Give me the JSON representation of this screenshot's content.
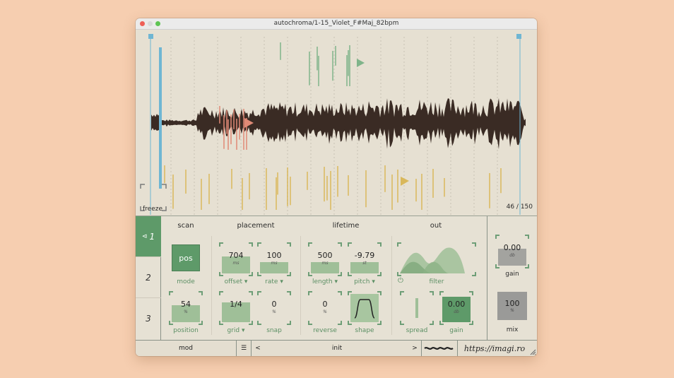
{
  "window": {
    "title": "autochroma/1-15_Violet_F#Maj_82bpm",
    "traffic_colors": [
      "#ee5f57",
      "#d9d9d9",
      "#5fc454"
    ]
  },
  "waveform": {
    "freeze_label": "freeze",
    "counter": "46 / 150",
    "colors": {
      "wave": "#3a2b24",
      "red": "#e08a76",
      "green": "#7fb48a",
      "yellow": "#d9b85b",
      "blue": "#6fb6d3"
    }
  },
  "sections": {
    "scan": "scan",
    "placement": "placement",
    "lifetime": "lifetime",
    "out": "out"
  },
  "tabs": [
    "1",
    "2",
    "3"
  ],
  "scan": {
    "mode": {
      "value": "pos",
      "label": "mode"
    },
    "position": {
      "value": "54",
      "unit": "%",
      "label": "position",
      "fill": 0.45
    }
  },
  "placement": {
    "offset": {
      "value": "704",
      "unit": "ms",
      "label": "offset",
      "fill": 0.55
    },
    "rate": {
      "value": "100",
      "unit": "ms",
      "label": "rate",
      "fill": 0.35
    },
    "grid": {
      "value": "1/4",
      "unit": "",
      "label": "grid",
      "fill": 0.6
    },
    "snap": {
      "value": "0",
      "unit": "%",
      "label": "snap",
      "fill": 0.0
    }
  },
  "lifetime": {
    "length": {
      "value": "500",
      "unit": "ms",
      "label": "length",
      "fill": 0.35
    },
    "pitch": {
      "value": "-9.79",
      "unit": "st",
      "label": "pitch",
      "fill": 0.35
    },
    "reverse": {
      "value": "0",
      "unit": "%",
      "label": "reverse",
      "fill": 0.0
    },
    "shape": {
      "label": "shape"
    }
  },
  "out": {
    "filter": {
      "label": "filter"
    },
    "spread": {
      "label": "spread"
    },
    "gain": {
      "value": "0.00",
      "unit": "db",
      "label": "gain",
      "fill": 0.7
    }
  },
  "master": {
    "gain": {
      "value": "0.00",
      "unit": "db",
      "label": "gain"
    },
    "mix": {
      "value": "100",
      "unit": "%",
      "label": "mix"
    }
  },
  "bottombar": {
    "mod": "mod",
    "prev": "<",
    "preset": "init",
    "next": ">",
    "url": "https://imagi.ro"
  }
}
